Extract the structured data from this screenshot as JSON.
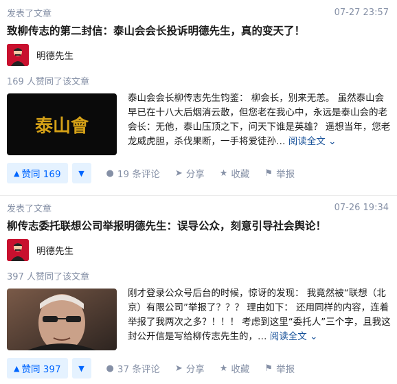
{
  "feed": [
    {
      "meta": "发表了文章",
      "time": "07-27 23:57",
      "title": "致柳传志的第二封信：泰山会会长投诉明德先生，真的变天了！",
      "author": "明德先生",
      "votes_text": "169 人赞同了该文章",
      "thumb_text": "泰山會",
      "excerpt": "泰山会会长柳传志先生钧鉴：   柳会长，别来无恙。 虽然泰山会早已在十八大后烟消云散，但您老在我心中，永远是泰山会的老会长：无他，泰山压顶之下，问天下谁是英雄？ 遥想当年，您老龙威虎胆，杀伐果断，一手将爱徒孙…",
      "read_more": "阅读全文",
      "upvote_label": "赞同 169",
      "comments_label": "19 条评论",
      "share_label": "分享",
      "collect_label": "收藏",
      "report_label": "举报"
    },
    {
      "meta": "发表了文章",
      "time": "07-26 19:34",
      "title": "柳传志委托联想公司举报明德先生：误导公众，刻意引导社会舆论！",
      "author": "明德先生",
      "votes_text": "397 人赞同了该文章",
      "excerpt": "刚才登录公众号后台的时候，惊讶的发现： 我竟然被“联想（北京）有限公司”举报了？？？ 理由如下： 还用同样的内容，连着举报了我两次之多？！！！ 考虑到这里“委托人”三个字，且我这封公开信是写给柳传志先生的，…",
      "read_more": "阅读全文",
      "upvote_label": "赞同 397",
      "comments_label": "37 条评论",
      "share_label": "分享",
      "collect_label": "收藏",
      "report_label": "举报"
    }
  ],
  "icons": {
    "upvote": "triangle-up-icon",
    "downvote": "triangle-down-icon",
    "comment": "comment-bubble-icon",
    "share": "share-plane-icon",
    "collect": "star-icon",
    "report": "flag-icon",
    "readmore": "chevron-down-icon"
  },
  "colors": {
    "accent": "#0066ff",
    "vote_bg": "#e5f2ff",
    "muted": "#8590a6",
    "link": "#175199",
    "avatar": "#c8102e",
    "thumb_text": "#d4a017"
  }
}
